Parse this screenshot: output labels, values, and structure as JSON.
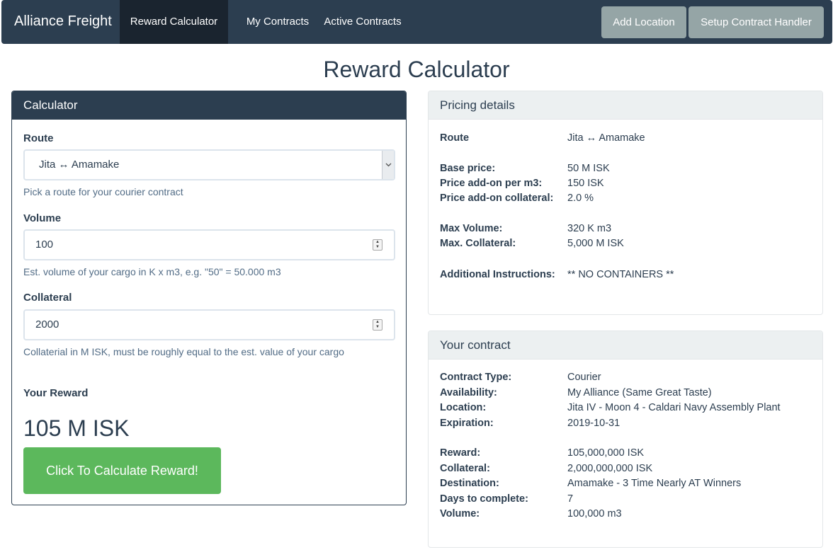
{
  "navbar": {
    "brand": "Alliance Freight",
    "items": [
      {
        "label": "Reward Calculator"
      },
      {
        "label": "My Contracts"
      },
      {
        "label": "Active Contracts"
      }
    ],
    "buttons": [
      {
        "label": "Add Location"
      },
      {
        "label": "Setup Contract Handler"
      }
    ]
  },
  "page_title": "Reward Calculator",
  "calculator": {
    "title": "Calculator",
    "route_label": "Route",
    "route_value": "Jita ↔ Amamake",
    "route_help": "Pick a route for your courier contract",
    "volume_label": "Volume",
    "volume_value": "100",
    "volume_help": "Est. volume of your cargo in K x m3, e.g. \"50\" = 50.000 m3",
    "collateral_label": "Collateral",
    "collateral_value": "2000",
    "collateral_help": "Collaterial in M ISK, must be roughly equal to the est. value of your cargo",
    "reward_label": "Your Reward",
    "reward_value": "105 M ISK",
    "button_label": "Click To Calculate Reward!"
  },
  "pricing": {
    "title": "Pricing details",
    "rows": [
      {
        "key": "Route",
        "value": "Jita ↔ Amamake"
      },
      {
        "key": "Base price:",
        "value": "50 M ISK"
      },
      {
        "key": "Price add-on per m3:",
        "value": "150 ISK"
      },
      {
        "key": "Price add-on collateral:",
        "value": "2.0 %"
      },
      {
        "key": "Max Volume:",
        "value": "320 K m3"
      },
      {
        "key": "Max. Collateral:",
        "value": "5,000 M ISK"
      },
      {
        "key": "Additional Instructions:",
        "value": "** NO CONTAINERS **"
      }
    ]
  },
  "contract": {
    "title": "Your contract",
    "rows": [
      {
        "key": "Contract Type:",
        "value": "Courier"
      },
      {
        "key": "Availability:",
        "value": "My Alliance (Same Great Taste)"
      },
      {
        "key": "Location:",
        "value": "Jita IV - Moon 4 - Caldari Navy Assembly Plant"
      },
      {
        "key": "Expiration:",
        "value": "2019-10-31"
      },
      {
        "key": "Reward:",
        "value": "105,000,000 ISK"
      },
      {
        "key": "Collateral:",
        "value": "2,000,000,000 ISK"
      },
      {
        "key": "Destination:",
        "value": "Amamake - 3 Time Nearly AT Winners"
      },
      {
        "key": "Days to complete:",
        "value": "7"
      },
      {
        "key": "Volume:",
        "value": "100,000 m3"
      }
    ]
  },
  "colors": {
    "primary": "#2c3e50",
    "secondary": "#95a5a6",
    "success": "#5cb85c",
    "muted_text": "#526c86",
    "panel_header": "#ecf0f1"
  }
}
